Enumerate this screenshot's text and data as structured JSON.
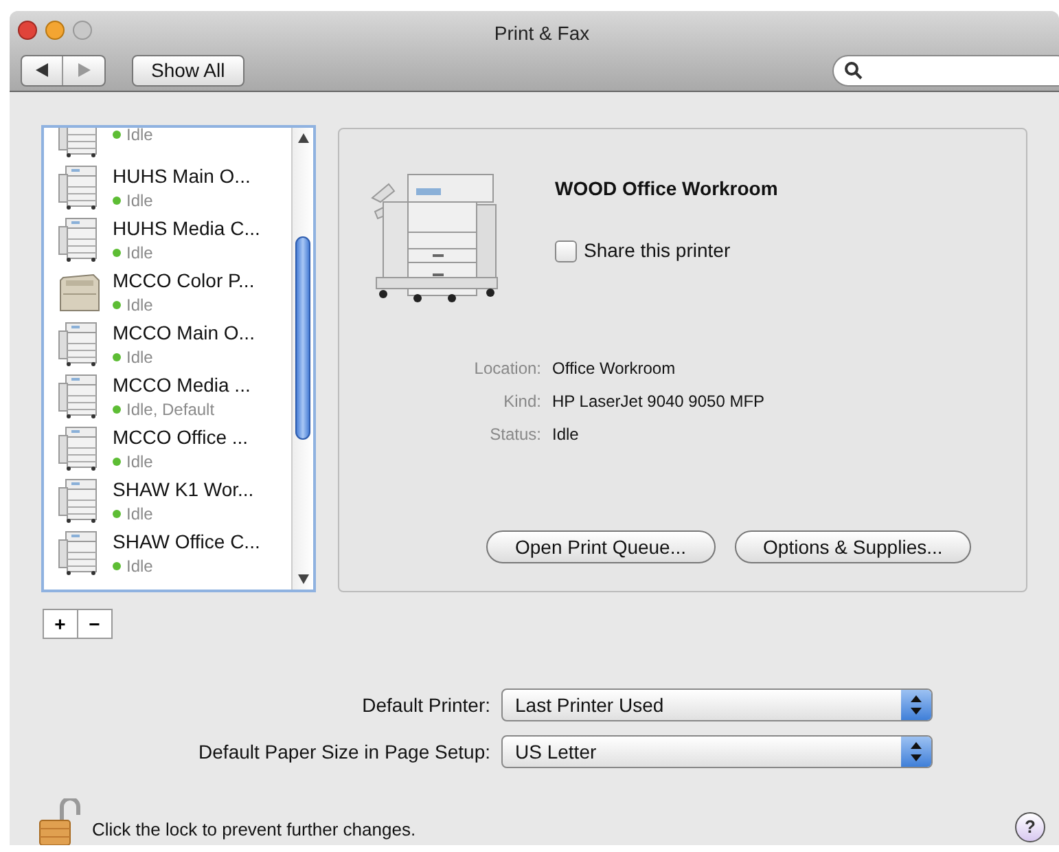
{
  "window": {
    "title": "Print & Fax"
  },
  "toolbar": {
    "show_all": "Show All"
  },
  "printers": [
    {
      "status": "Idle",
      "kind": "mfp",
      "selected": false
    },
    {
      "name": "HUHS Main O...",
      "status": "Idle",
      "kind": "mfp",
      "selected": false
    },
    {
      "name": "HUHS Media C...",
      "status": "Idle",
      "kind": "mfp",
      "selected": false
    },
    {
      "name": "MCCO Color P...",
      "status": "Idle",
      "kind": "color",
      "selected": false
    },
    {
      "name": "MCCO Main O...",
      "status": "Idle",
      "kind": "mfp",
      "selected": false
    },
    {
      "name": "MCCO Media ...",
      "status": "Idle, Default",
      "kind": "mfp",
      "selected": false
    },
    {
      "name": "MCCO Office ...",
      "status": "Idle",
      "kind": "mfp",
      "selected": false
    },
    {
      "name": "SHAW K1 Wor...",
      "status": "Idle",
      "kind": "mfp",
      "selected": false
    },
    {
      "name": "SHAW Office C...",
      "status": "Idle",
      "kind": "mfp",
      "selected": false
    }
  ],
  "list_buttons": [
    "+",
    "−"
  ],
  "detail": {
    "name": "WOOD Office Workroom",
    "share": {
      "label": "Share this printer",
      "checked": false
    },
    "fields": [
      {
        "label": "Location:",
        "value": "Office Workroom"
      },
      {
        "label": "Kind:",
        "value": "HP LaserJet 9040 9050 MFP"
      },
      {
        "label": "Status:",
        "value": "Idle"
      }
    ],
    "buttons": [
      "Open Print Queue...",
      "Options & Supplies..."
    ]
  },
  "settings": [
    {
      "label": "Default Printer:",
      "value": "Last Printer Used"
    },
    {
      "label": "Default Paper Size in Page Setup:",
      "value": "US Letter"
    }
  ],
  "lock_text": "Click the lock to prevent further changes.",
  "help": "?"
}
